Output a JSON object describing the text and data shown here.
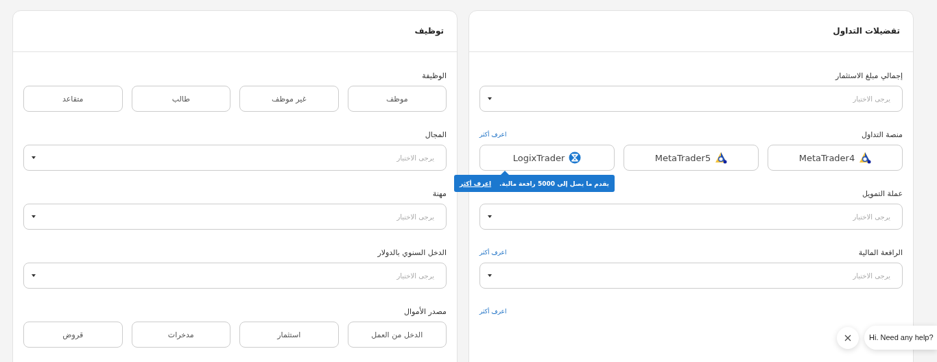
{
  "employment": {
    "title": "توظيف",
    "fields": [
      {
        "kind": "choices",
        "label": "الوظيفة",
        "options": [
          {
            "label": "موظف",
            "selected": false
          },
          {
            "label": "غير موظف",
            "selected": false
          },
          {
            "label": "طالب",
            "selected": false
          },
          {
            "label": "متقاعد",
            "selected": false
          }
        ]
      },
      {
        "kind": "select",
        "label": "المجال",
        "placeholder": "يرجى الاختيار"
      },
      {
        "kind": "select",
        "label": "مهنة",
        "placeholder": "يرجى الاختيار"
      },
      {
        "kind": "select",
        "label": "الدخل السنوي بالدولار",
        "placeholder": "يرجى الاختيار"
      },
      {
        "kind": "choices",
        "label": "مصدر الأموال",
        "options": [
          {
            "label": "الدخل من العمل",
            "selected": false
          },
          {
            "label": "استثمار",
            "selected": false
          },
          {
            "label": "مدخرات",
            "selected": false
          },
          {
            "label": "قروض",
            "selected": false
          }
        ]
      }
    ]
  },
  "trading_preferences": {
    "title": "تفضيلات التداول",
    "fields": [
      {
        "kind": "select",
        "label": "إجمالي مبلغ الاستثمار",
        "placeholder": "يرجى الاختيار"
      },
      {
        "kind": "platforms",
        "label": "منصة التداول",
        "link": "اعرف أكثر",
        "options": [
          {
            "label": "MetaTrader4",
            "kind": "triangle",
            "selected": false
          },
          {
            "label": "MetaTrader5",
            "kind": "triangle",
            "selected": false
          },
          {
            "label": "LogixTrader",
            "kind": "hourglass",
            "selected": false,
            "tooltip": {
              "text": "يقدم ما يصل إلى 5000 رافعة مالية.",
              "link": "اعرف أكثر"
            }
          }
        ]
      },
      {
        "kind": "select",
        "label": "عملة التمويل",
        "placeholder": "يرجى الاختيار"
      },
      {
        "kind": "select",
        "label": "الرافعة المالية",
        "link": "اعرف أكثر",
        "placeholder": "يرجى الاختيار"
      },
      {
        "kind": "link",
        "link": "اعرف أكثر"
      }
    ]
  },
  "chat_widget": {
    "message": "Hi. Need any help?"
  }
}
